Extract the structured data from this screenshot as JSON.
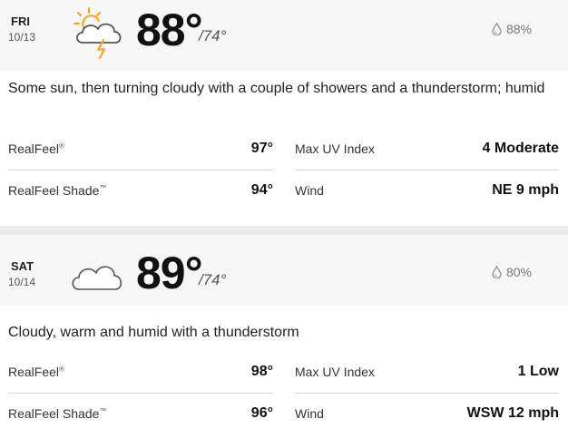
{
  "days": [
    {
      "dow": "FRI",
      "date": "10/13",
      "icon": "partly-sunny-thunderstorm-icon",
      "high": "88°",
      "low": "/74°",
      "precip": "88%",
      "phrase": "Some sun, then turning cloudy with a couple of showers and a thunderstorm; humid",
      "details": {
        "realfeel_label": "RealFeel",
        "realfeel_tm": "®",
        "realfeel_value": "97°",
        "realfeel_shade_label": "RealFeel Shade",
        "realfeel_shade_tm": "™",
        "realfeel_shade_value": "94°",
        "uv_label": "Max UV Index",
        "uv_value": "4 Moderate",
        "wind_label": "Wind",
        "wind_value": "NE 9 mph"
      }
    },
    {
      "dow": "SAT",
      "date": "10/14",
      "icon": "cloudy-icon",
      "high": "89°",
      "low": "/74°",
      "precip": "80%",
      "phrase": "Cloudy, warm and humid with a thunderstorm",
      "details": {
        "realfeel_label": "RealFeel",
        "realfeel_tm": "®",
        "realfeel_value": "98°",
        "realfeel_shade_label": "RealFeel Shade",
        "realfeel_shade_tm": "™",
        "realfeel_shade_value": "96°",
        "uv_label": "Max UV Index",
        "uv_value": "1 Low",
        "wind_label": "Wind",
        "wind_value": "WSW 12 mph"
      }
    }
  ],
  "colors": {
    "sun": "#f7a21b",
    "cloud_stroke": "#555555",
    "header_bg": "#f6f6f6",
    "divider": "#ebebeb"
  }
}
